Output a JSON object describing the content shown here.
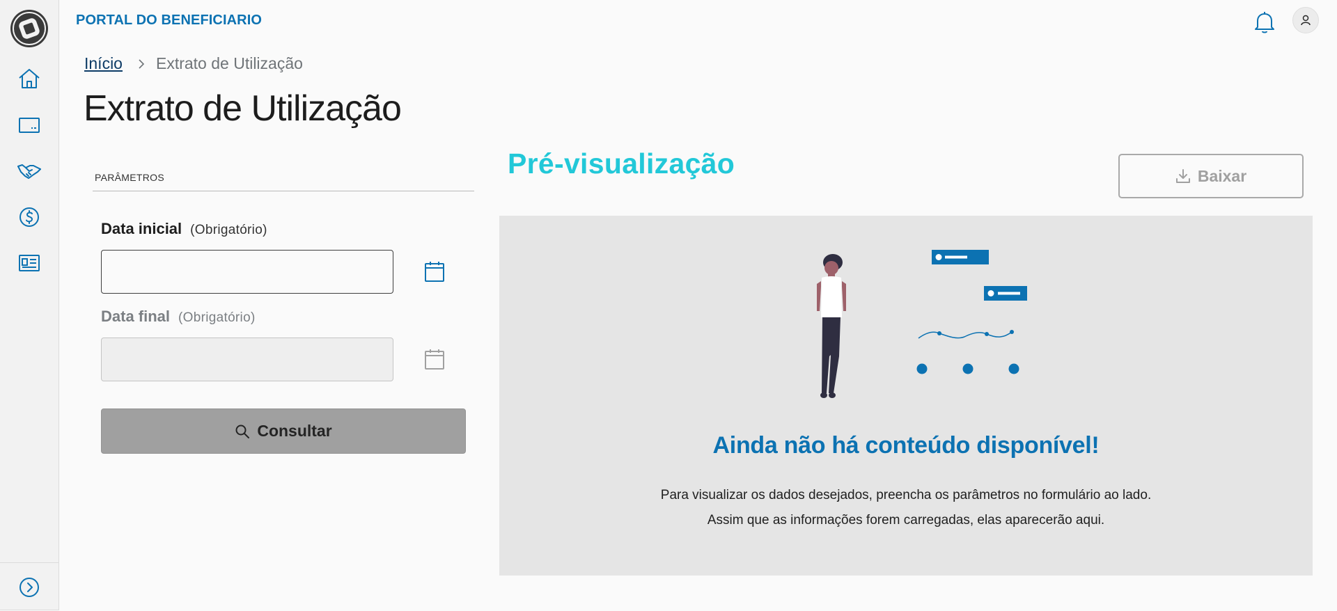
{
  "app": {
    "title": "PORTAL DO BENEFICIARIO"
  },
  "sidebar": {
    "items": [
      {
        "icon": "home-icon"
      },
      {
        "icon": "card-icon"
      },
      {
        "icon": "handshake-icon"
      },
      {
        "icon": "dollar-icon"
      },
      {
        "icon": "receipt-icon"
      }
    ],
    "expand_icon": "chevron-right-circle-icon"
  },
  "breadcrumb": {
    "home": "Início",
    "current": "Extrato de Utilização"
  },
  "page": {
    "title": "Extrato de Utilização"
  },
  "params": {
    "section_label": "PARÂMETROS",
    "start_date": {
      "label": "Data inicial",
      "optional": "(Obrigatório)",
      "value": "",
      "disabled": false
    },
    "end_date": {
      "label": "Data final",
      "optional": "(Obrigatório)",
      "value": "",
      "disabled": true
    },
    "submit_label": "Consultar"
  },
  "preview": {
    "title": "Pré-visualização",
    "download_label": "Baixar",
    "empty_title": "Ainda não há conteúdo disponível!",
    "empty_text": "Para visualizar os dados desejados, preencha os parâmetros no formulário ao lado. Assim que as informações forem carregadas, elas aparecerão aqui."
  },
  "colors": {
    "brand": "#0c72b2",
    "accent": "#22c8d8",
    "disabled": "#a0a0a0"
  }
}
